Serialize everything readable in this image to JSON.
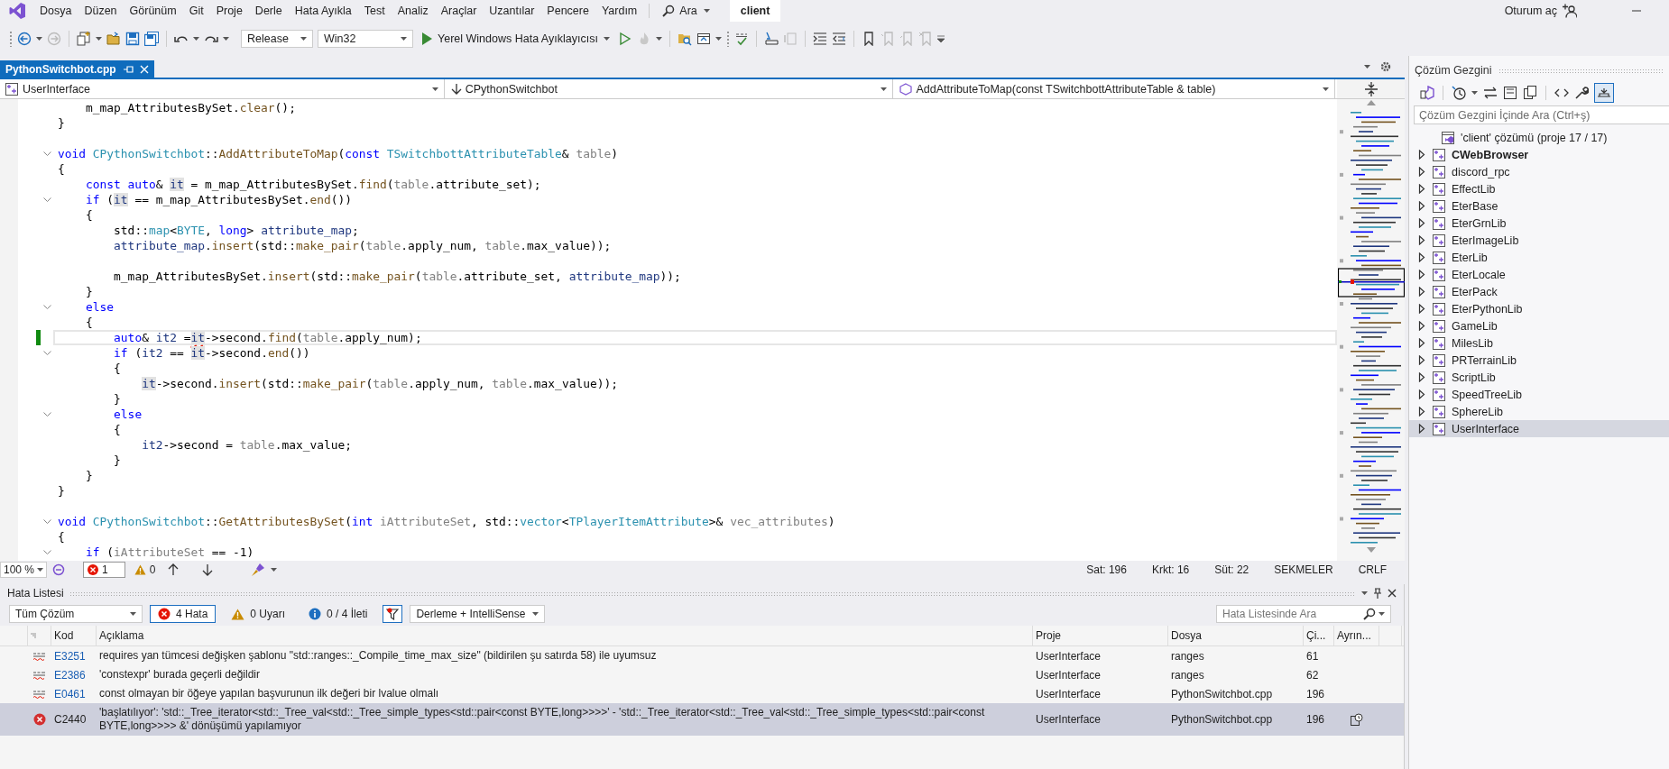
{
  "title_bar": {
    "menu": [
      "Dosya",
      "Düzen",
      "Görünüm",
      "Git",
      "Proje",
      "Derle",
      "Hata Ayıkla",
      "Test",
      "Analiz",
      "Araçlar",
      "Uzantılar",
      "Pencere",
      "Yardım"
    ],
    "search": "Ara",
    "solution_name": "client",
    "sign_in": "Oturum aç"
  },
  "toolbar": {
    "configuration": "Release",
    "platform": "Win32",
    "start": "Yerel Windows Hata Ayıklayıcısı"
  },
  "editor": {
    "tabs": [
      {
        "label": "PythonSwitchbot.cpp",
        "selected": true
      }
    ],
    "navigation": {
      "project": "UserInterface",
      "scope": "CPythonSwitchbot",
      "member": "AddAttributeToMap(const TSwitchbottAttributeTable & table)"
    },
    "lines": [
      {
        "kind": "code",
        "fold": false,
        "current": false,
        "changed": false,
        "tokens": [
          {
            "kind": "plain",
            "text": "    m_map_AttributesBySet."
          },
          {
            "kind": "function",
            "text": "clear"
          },
          {
            "kind": "plain",
            "text": "();"
          }
        ]
      },
      {
        "kind": "code",
        "fold": false,
        "current": false,
        "changed": false,
        "tokens": [
          {
            "kind": "plain",
            "text": "}"
          }
        ]
      },
      {
        "kind": "blank",
        "fold": false,
        "current": false,
        "changed": false
      },
      {
        "kind": "code",
        "fold": true,
        "current": false,
        "changed": false,
        "tokens": [
          {
            "kind": "keyword",
            "text": "void "
          },
          {
            "kind": "type",
            "text": "CPythonSwitchbot"
          },
          {
            "kind": "plain",
            "text": "::"
          },
          {
            "kind": "function",
            "text": "AddAttributeToMap"
          },
          {
            "kind": "plain",
            "text": "("
          },
          {
            "kind": "keyword",
            "text": "const "
          },
          {
            "kind": "type",
            "text": "TSwitchbottAttributeTable"
          },
          {
            "kind": "plain",
            "text": "& "
          },
          {
            "kind": "param",
            "text": "table"
          },
          {
            "kind": "plain",
            "text": ")"
          }
        ]
      },
      {
        "kind": "code",
        "fold": false,
        "current": false,
        "changed": false,
        "tokens": [
          {
            "kind": "plain",
            "text": "{"
          }
        ]
      },
      {
        "kind": "code",
        "fold": false,
        "current": false,
        "changed": false,
        "tokens": [
          {
            "kind": "keyword",
            "text": "    const auto"
          },
          {
            "kind": "plain",
            "text": "& "
          },
          {
            "kind": "reference",
            "text": "it"
          },
          {
            "kind": "plain",
            "text": " = m_map_AttributesBySet."
          },
          {
            "kind": "function",
            "text": "find"
          },
          {
            "kind": "plain",
            "text": "("
          },
          {
            "kind": "param",
            "text": "table"
          },
          {
            "kind": "plain",
            "text": ".attribute_set);"
          }
        ]
      },
      {
        "kind": "code",
        "fold": true,
        "current": false,
        "changed": false,
        "tokens": [
          {
            "kind": "keyword",
            "text": "    if"
          },
          {
            "kind": "plain",
            "text": " ("
          },
          {
            "kind": "reference",
            "text": "it"
          },
          {
            "kind": "plain",
            "text": " == m_map_AttributesBySet."
          },
          {
            "kind": "function",
            "text": "end"
          },
          {
            "kind": "plain",
            "text": "())"
          }
        ]
      },
      {
        "kind": "code",
        "fold": false,
        "current": false,
        "changed": false,
        "tokens": [
          {
            "kind": "plain",
            "text": "    {"
          }
        ]
      },
      {
        "kind": "code",
        "fold": false,
        "current": false,
        "changed": false,
        "tokens": [
          {
            "kind": "plain",
            "text": "        std::"
          },
          {
            "kind": "type",
            "text": "map"
          },
          {
            "kind": "plain",
            "text": "<"
          },
          {
            "kind": "type",
            "text": "BYTE"
          },
          {
            "kind": "plain",
            "text": ", "
          },
          {
            "kind": "keyword",
            "text": "long"
          },
          {
            "kind": "plain",
            "text": "> "
          },
          {
            "kind": "local",
            "text": "attribute_map"
          },
          {
            "kind": "plain",
            "text": ";"
          }
        ]
      },
      {
        "kind": "code",
        "fold": false,
        "current": false,
        "changed": false,
        "tokens": [
          {
            "kind": "local",
            "text": "        attribute_map"
          },
          {
            "kind": "plain",
            "text": "."
          },
          {
            "kind": "function",
            "text": "insert"
          },
          {
            "kind": "plain",
            "text": "(std::"
          },
          {
            "kind": "function",
            "text": "make_pair"
          },
          {
            "kind": "plain",
            "text": "("
          },
          {
            "kind": "param",
            "text": "table"
          },
          {
            "kind": "plain",
            "text": ".apply_num, "
          },
          {
            "kind": "param",
            "text": "table"
          },
          {
            "kind": "plain",
            "text": ".max_value));"
          }
        ]
      },
      {
        "kind": "blank",
        "fold": false,
        "current": false,
        "changed": false
      },
      {
        "kind": "code",
        "fold": false,
        "current": false,
        "changed": false,
        "tokens": [
          {
            "kind": "plain",
            "text": "        m_map_AttributesBySet."
          },
          {
            "kind": "function",
            "text": "insert"
          },
          {
            "kind": "plain",
            "text": "(std::"
          },
          {
            "kind": "function",
            "text": "make_pair"
          },
          {
            "kind": "plain",
            "text": "("
          },
          {
            "kind": "param",
            "text": "table"
          },
          {
            "kind": "plain",
            "text": ".attribute_set, "
          },
          {
            "kind": "local",
            "text": "attribute_map"
          },
          {
            "kind": "plain",
            "text": "));"
          }
        ]
      },
      {
        "kind": "code",
        "fold": false,
        "current": false,
        "changed": false,
        "tokens": [
          {
            "kind": "plain",
            "text": "    }"
          }
        ]
      },
      {
        "kind": "code",
        "fold": true,
        "current": false,
        "changed": false,
        "tokens": [
          {
            "kind": "keyword",
            "text": "    else"
          }
        ]
      },
      {
        "kind": "code",
        "fold": false,
        "current": false,
        "changed": false,
        "tokens": [
          {
            "kind": "plain",
            "text": "    {"
          }
        ]
      },
      {
        "kind": "code",
        "fold": false,
        "current": true,
        "changed": true,
        "tokens": [
          {
            "kind": "keyword",
            "text": "        auto"
          },
          {
            "kind": "plain",
            "text": "& "
          },
          {
            "kind": "local",
            "text": "it2"
          },
          {
            "kind": "plain",
            "text": " ="
          },
          {
            "kind": "error",
            "text": "it"
          },
          {
            "kind": "plain",
            "text": "->second."
          },
          {
            "kind": "function",
            "text": "find"
          },
          {
            "kind": "plain",
            "text": "("
          },
          {
            "kind": "param",
            "text": "table"
          },
          {
            "kind": "plain",
            "text": ".apply_num);"
          }
        ]
      },
      {
        "kind": "code",
        "fold": true,
        "current": false,
        "changed": false,
        "tokens": [
          {
            "kind": "keyword",
            "text": "        if"
          },
          {
            "kind": "plain",
            "text": " ("
          },
          {
            "kind": "local",
            "text": "it2"
          },
          {
            "kind": "plain",
            "text": " == "
          },
          {
            "kind": "reference",
            "text": "it"
          },
          {
            "kind": "plain",
            "text": "->second."
          },
          {
            "kind": "function",
            "text": "end"
          },
          {
            "kind": "plain",
            "text": "())"
          }
        ]
      },
      {
        "kind": "code",
        "fold": false,
        "current": false,
        "changed": false,
        "tokens": [
          {
            "kind": "plain",
            "text": "        {"
          }
        ]
      },
      {
        "kind": "code",
        "fold": false,
        "current": false,
        "changed": false,
        "tokens": [
          {
            "kind": "reference",
            "text": "            it"
          },
          {
            "kind": "plain",
            "text": "->second."
          },
          {
            "kind": "function",
            "text": "insert"
          },
          {
            "kind": "plain",
            "text": "(std::"
          },
          {
            "kind": "function",
            "text": "make_pair"
          },
          {
            "kind": "plain",
            "text": "("
          },
          {
            "kind": "param",
            "text": "table"
          },
          {
            "kind": "plain",
            "text": ".apply_num, "
          },
          {
            "kind": "param",
            "text": "table"
          },
          {
            "kind": "plain",
            "text": ".max_value));"
          }
        ]
      },
      {
        "kind": "code",
        "fold": false,
        "current": false,
        "changed": false,
        "tokens": [
          {
            "kind": "plain",
            "text": "        }"
          }
        ]
      },
      {
        "kind": "code",
        "fold": true,
        "current": false,
        "changed": false,
        "tokens": [
          {
            "kind": "keyword",
            "text": "        else"
          }
        ]
      },
      {
        "kind": "code",
        "fold": false,
        "current": false,
        "changed": false,
        "tokens": [
          {
            "kind": "plain",
            "text": "        {"
          }
        ]
      },
      {
        "kind": "code",
        "fold": false,
        "current": false,
        "changed": false,
        "tokens": [
          {
            "kind": "local",
            "text": "            it2"
          },
          {
            "kind": "plain",
            "text": "->second = "
          },
          {
            "kind": "param",
            "text": "table"
          },
          {
            "kind": "plain",
            "text": ".max_value;"
          }
        ]
      },
      {
        "kind": "code",
        "fold": false,
        "current": false,
        "changed": false,
        "tokens": [
          {
            "kind": "plain",
            "text": "        }"
          }
        ]
      },
      {
        "kind": "code",
        "fold": false,
        "current": false,
        "changed": false,
        "tokens": [
          {
            "kind": "plain",
            "text": "    }"
          }
        ]
      },
      {
        "kind": "code",
        "fold": false,
        "current": false,
        "changed": false,
        "tokens": [
          {
            "kind": "plain",
            "text": "}"
          }
        ]
      },
      {
        "kind": "blank",
        "fold": false,
        "current": false,
        "changed": false
      },
      {
        "kind": "code",
        "fold": true,
        "current": false,
        "changed": false,
        "tokens": [
          {
            "kind": "keyword",
            "text": "void "
          },
          {
            "kind": "type",
            "text": "CPythonSwitchbot"
          },
          {
            "kind": "plain",
            "text": "::"
          },
          {
            "kind": "function",
            "text": "GetAttributesBySet"
          },
          {
            "kind": "plain",
            "text": "("
          },
          {
            "kind": "keyword",
            "text": "int "
          },
          {
            "kind": "param",
            "text": "iAttributeSet"
          },
          {
            "kind": "plain",
            "text": ", std::"
          },
          {
            "kind": "type",
            "text": "vector"
          },
          {
            "kind": "plain",
            "text": "<"
          },
          {
            "kind": "type",
            "text": "TPlayerItemAttribute"
          },
          {
            "kind": "plain",
            "text": ">& "
          },
          {
            "kind": "param",
            "text": "vec_attributes"
          },
          {
            "kind": "plain",
            "text": ")"
          }
        ]
      },
      {
        "kind": "code",
        "fold": false,
        "current": false,
        "changed": false,
        "tokens": [
          {
            "kind": "plain",
            "text": "{"
          }
        ]
      },
      {
        "kind": "code",
        "fold": true,
        "current": false,
        "changed": false,
        "tokens": [
          {
            "kind": "keyword",
            "text": "    if"
          },
          {
            "kind": "plain",
            "text": " ("
          },
          {
            "kind": "param",
            "text": "iAttributeSet"
          },
          {
            "kind": "plain",
            "text": " == -1)"
          }
        ]
      }
    ],
    "status": {
      "zoom": "100 %",
      "errors": "1",
      "warnings": "0",
      "line": "Sat: 196",
      "character": "Krkt: 16",
      "column": "Süt: 22",
      "indent": "SEKMELER",
      "line_ending": "CRLF"
    }
  },
  "error_list": {
    "title": "Hata Listesi",
    "scope": "Tüm Çözüm",
    "filters": [
      {
        "kind": "error",
        "label": "4 Hata",
        "selected": true
      },
      {
        "kind": "warning",
        "label": "0 Uyarı",
        "selected": false
      },
      {
        "kind": "message",
        "label": "0 / 4 İleti",
        "selected": false
      }
    ],
    "filter_on": true,
    "source": "Derleme + IntelliSense",
    "search_placeholder": "Hata Listesinde Ara",
    "columns": [
      "Kod",
      "Açıklama",
      "Proje",
      "Dosya",
      "Çi...",
      "Ayrın..."
    ],
    "rows": [
      {
        "kind": "intellisense",
        "code": "E3251",
        "description": "requires yan tümcesi değişken şablonu \"std::ranges::_Compile_time_max_size\" (bildirilen şu satırda 58) ile uyumsuz",
        "project": "UserInterface",
        "file": "ranges",
        "line": "61",
        "details": false,
        "selected": false
      },
      {
        "kind": "intellisense",
        "code": "E2386",
        "description": "'constexpr' burada geçerli değildir",
        "project": "UserInterface",
        "file": "ranges",
        "line": "62",
        "details": false,
        "selected": false
      },
      {
        "kind": "intellisense",
        "code": "E0461",
        "description": "const olmayan bir öğeye yapılan başvurunun ilk değeri bir lvalue olmalı",
        "project": "UserInterface",
        "file": "PythonSwitchbot.cpp",
        "line": "196",
        "details": false,
        "selected": false
      },
      {
        "kind": "build",
        "code": "C2440",
        "description": "'başlatılıyor': 'std::_Tree_iterator<std::_Tree_val<std::_Tree_simple_types<std::pair<const BYTE,long>>>>' - 'std::_Tree_iterator<std::_Tree_val<std::_Tree_simple_types<std::pair<const BYTE,long>>>> &' dönüşümü yapılamıyor",
        "project": "UserInterface",
        "file": "PythonSwitchbot.cpp",
        "line": "196",
        "details": true,
        "selected": true
      }
    ]
  },
  "solution_explorer": {
    "title": "Çözüm Gezgini",
    "preview_on": true,
    "search_placeholder": "Çözüm Gezgini İçinde Ara (Ctrl+ş)",
    "tree": [
      {
        "label": "'client' çözümü (proje 17 / 17)",
        "kind": "solution",
        "selected": false,
        "children": [
          {
            "label": "CWebBrowser",
            "kind": "project",
            "startup": true,
            "expanded": false,
            "selected": false
          },
          {
            "label": "discord_rpc",
            "kind": "project",
            "startup": false,
            "expanded": false,
            "selected": false
          },
          {
            "label": "EffectLib",
            "kind": "project",
            "startup": false,
            "expanded": false,
            "selected": false
          },
          {
            "label": "EterBase",
            "kind": "project",
            "startup": false,
            "expanded": false,
            "selected": false
          },
          {
            "label": "EterGrnLib",
            "kind": "project",
            "startup": false,
            "expanded": false,
            "selected": false
          },
          {
            "label": "EterImageLib",
            "kind": "project",
            "startup": false,
            "expanded": false,
            "selected": false
          },
          {
            "label": "EterLib",
            "kind": "project",
            "startup": false,
            "expanded": false,
            "selected": false
          },
          {
            "label": "EterLocale",
            "kind": "project",
            "startup": false,
            "expanded": false,
            "selected": false
          },
          {
            "label": "EterPack",
            "kind": "project",
            "startup": false,
            "expanded": false,
            "selected": false
          },
          {
            "label": "EterPythonLib",
            "kind": "project",
            "startup": false,
            "expanded": false,
            "selected": false
          },
          {
            "label": "GameLib",
            "kind": "project",
            "startup": false,
            "expanded": false,
            "selected": false
          },
          {
            "label": "MilesLib",
            "kind": "project",
            "startup": false,
            "expanded": false,
            "selected": false
          },
          {
            "label": "PRTerrainLib",
            "kind": "project",
            "startup": false,
            "expanded": false,
            "selected": false
          },
          {
            "label": "ScriptLib",
            "kind": "project",
            "startup": false,
            "expanded": false,
            "selected": false
          },
          {
            "label": "SpeedTreeLib",
            "kind": "project",
            "startup": false,
            "expanded": false,
            "selected": false
          },
          {
            "label": "SphereLib",
            "kind": "project",
            "startup": false,
            "expanded": false,
            "selected": false
          },
          {
            "label": "UserInterface",
            "kind": "project",
            "startup": false,
            "expanded": false,
            "selected": true
          }
        ]
      }
    ]
  }
}
